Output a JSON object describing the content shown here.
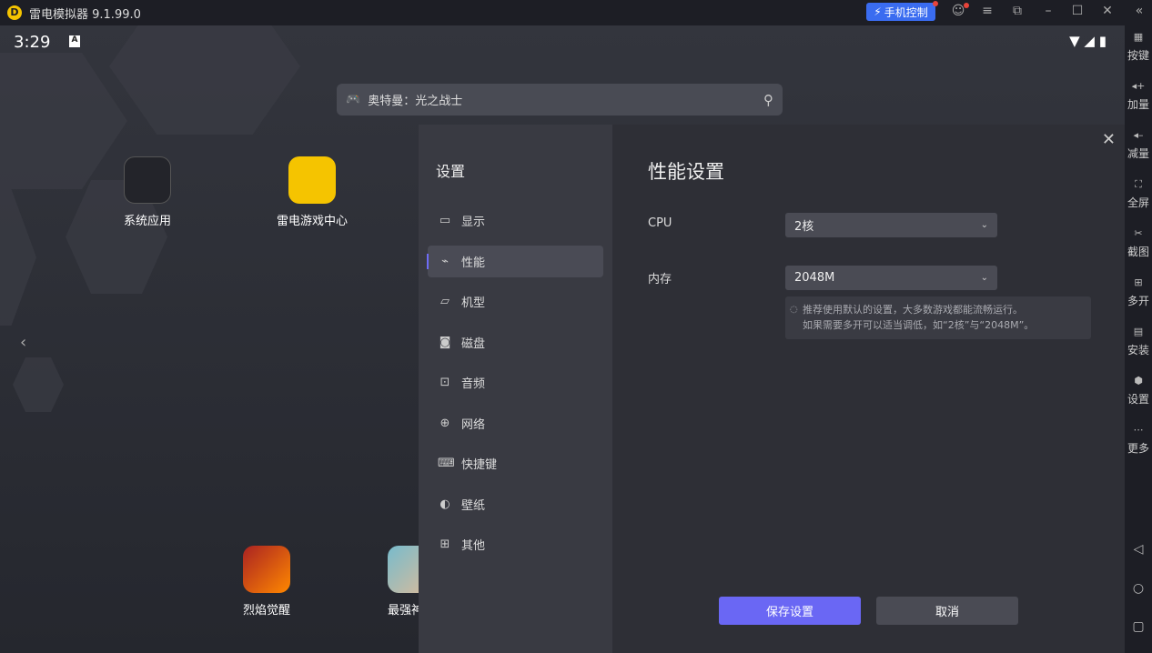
{
  "titlebar": {
    "title": "雷电模拟器 9.1.99.0",
    "phone_control": "手机控制"
  },
  "status": {
    "time": "3:29",
    "notif": "A"
  },
  "search": {
    "value": "奥特曼：光之战士"
  },
  "apps": [
    {
      "label": "系统应用"
    },
    {
      "label": "雷电游戏中心"
    },
    {
      "label": "烈焰觉醒"
    },
    {
      "label": "最强神"
    }
  ],
  "settings": {
    "title": "设置",
    "nav": [
      {
        "label": "显示",
        "icon": "monitor-icon"
      },
      {
        "label": "性能",
        "icon": "pulse-icon"
      },
      {
        "label": "机型",
        "icon": "folder-icon"
      },
      {
        "label": "磁盘",
        "icon": "disk-icon"
      },
      {
        "label": "音频",
        "icon": "gamepad-icon"
      },
      {
        "label": "网络",
        "icon": "globe-icon"
      },
      {
        "label": "快捷键",
        "icon": "keyboard-icon"
      },
      {
        "label": "壁纸",
        "icon": "palette-icon"
      },
      {
        "label": "其他",
        "icon": "grid-icon"
      }
    ],
    "page_title": "性能设置",
    "cpu_label": "CPU",
    "cpu_value": "2核",
    "mem_label": "内存",
    "mem_value": "2048M",
    "hint_line1": "推荐使用默认的设置，大多数游戏都能流畅运行。",
    "hint_line2": "如果需要多开可以适当调低，如“2核”与“2048M”。",
    "save": "保存设置",
    "cancel": "取消"
  },
  "sidebar": [
    {
      "label": "按键",
      "icon": "keyboard-icon"
    },
    {
      "label": "加量",
      "icon": "volume-up-icon"
    },
    {
      "label": "减量",
      "icon": "volume-down-icon"
    },
    {
      "label": "全屏",
      "icon": "fullscreen-icon"
    },
    {
      "label": "截图",
      "icon": "scissors-icon"
    },
    {
      "label": "多开",
      "icon": "multi-instance-icon"
    },
    {
      "label": "安装",
      "icon": "apk-icon"
    },
    {
      "label": "设置",
      "icon": "gear-icon"
    },
    {
      "label": "更多",
      "icon": "more-icon"
    }
  ],
  "colors": {
    "accent": "#6a67f4",
    "phone_btn": "#3a6cf0"
  }
}
